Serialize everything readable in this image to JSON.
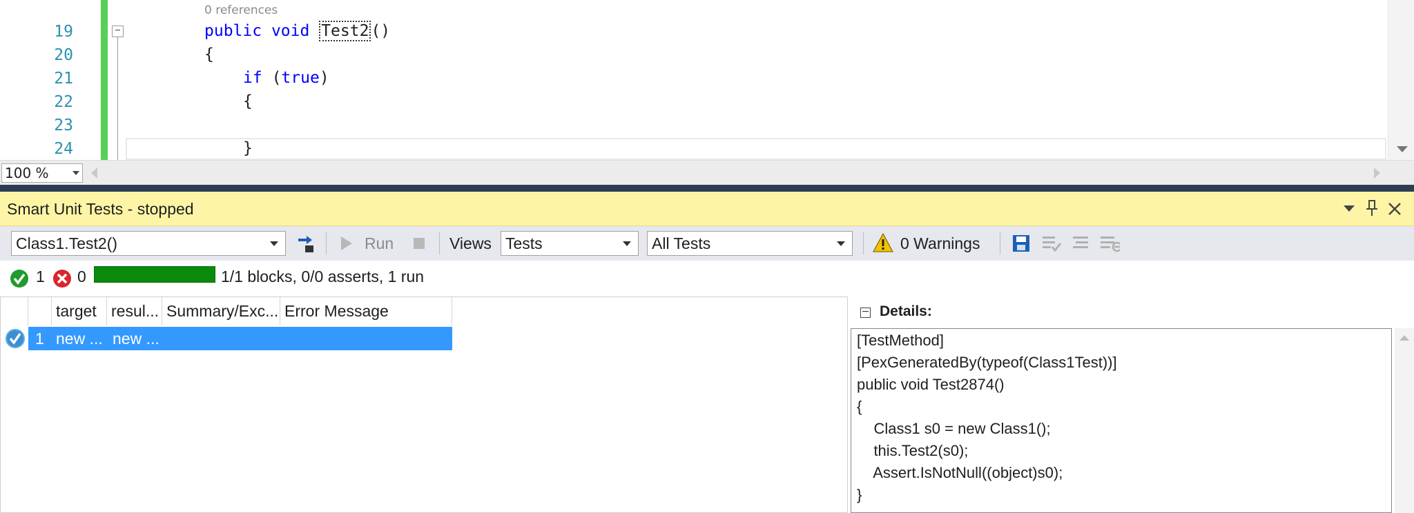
{
  "editor": {
    "codelens": "0 references",
    "lines": [
      {
        "num": "19"
      },
      {
        "num": "20"
      },
      {
        "num": "21"
      },
      {
        "num": "22"
      },
      {
        "num": "23"
      },
      {
        "num": "24"
      }
    ],
    "code": {
      "l19_kw1": "public",
      "l19_kw2": "void",
      "l19_ident": "Test2",
      "l19_rest": "()",
      "l20": "{",
      "l21_kw": "if",
      "l21_open": "(",
      "l21_true": "true",
      "l21_close": ")",
      "l22": "{",
      "l24": "}"
    },
    "zoom": "100 %",
    "fold_symbol": "−"
  },
  "tool_window": {
    "title": "Smart Unit Tests - stopped",
    "toolbar": {
      "method_combo": "Class1.Test2()",
      "run_label": "Run",
      "views_label": "Views",
      "views_combo": "Tests",
      "filter_combo": "All Tests",
      "warnings_label": "0 Warnings"
    },
    "status": {
      "passed_count": "1",
      "failed_count": "0",
      "progress_fraction": 1.0,
      "summary": "1/1 blocks, 0/0 asserts, 1 run"
    },
    "grid": {
      "columns": [
        "target",
        "resul...",
        "Summary/Exc...",
        "Error Message"
      ],
      "rows": [
        {
          "index": "1",
          "target": "new ...",
          "result": "new ..."
        }
      ]
    },
    "details": {
      "heading": "Details:",
      "toggle": "⊟",
      "code_lines": [
        "[TestMethod]",
        "[PexGeneratedBy(typeof(Class1Test))]",
        "public void Test2874()",
        "{",
        "    Class1 s0 = new Class1();",
        "    this.Test2(s0);",
        "    Assert.IsNotNull((object)s0);",
        "}"
      ]
    }
  },
  "colors": {
    "title_bg": "#fdf5a5",
    "selected_row": "#3399ff",
    "change_bar": "#57d057",
    "progress_fill": "#0a8a0a",
    "pass_icon": "#1f9a2e",
    "fail_icon": "#d9262e",
    "warning_icon": "#f2c200"
  }
}
